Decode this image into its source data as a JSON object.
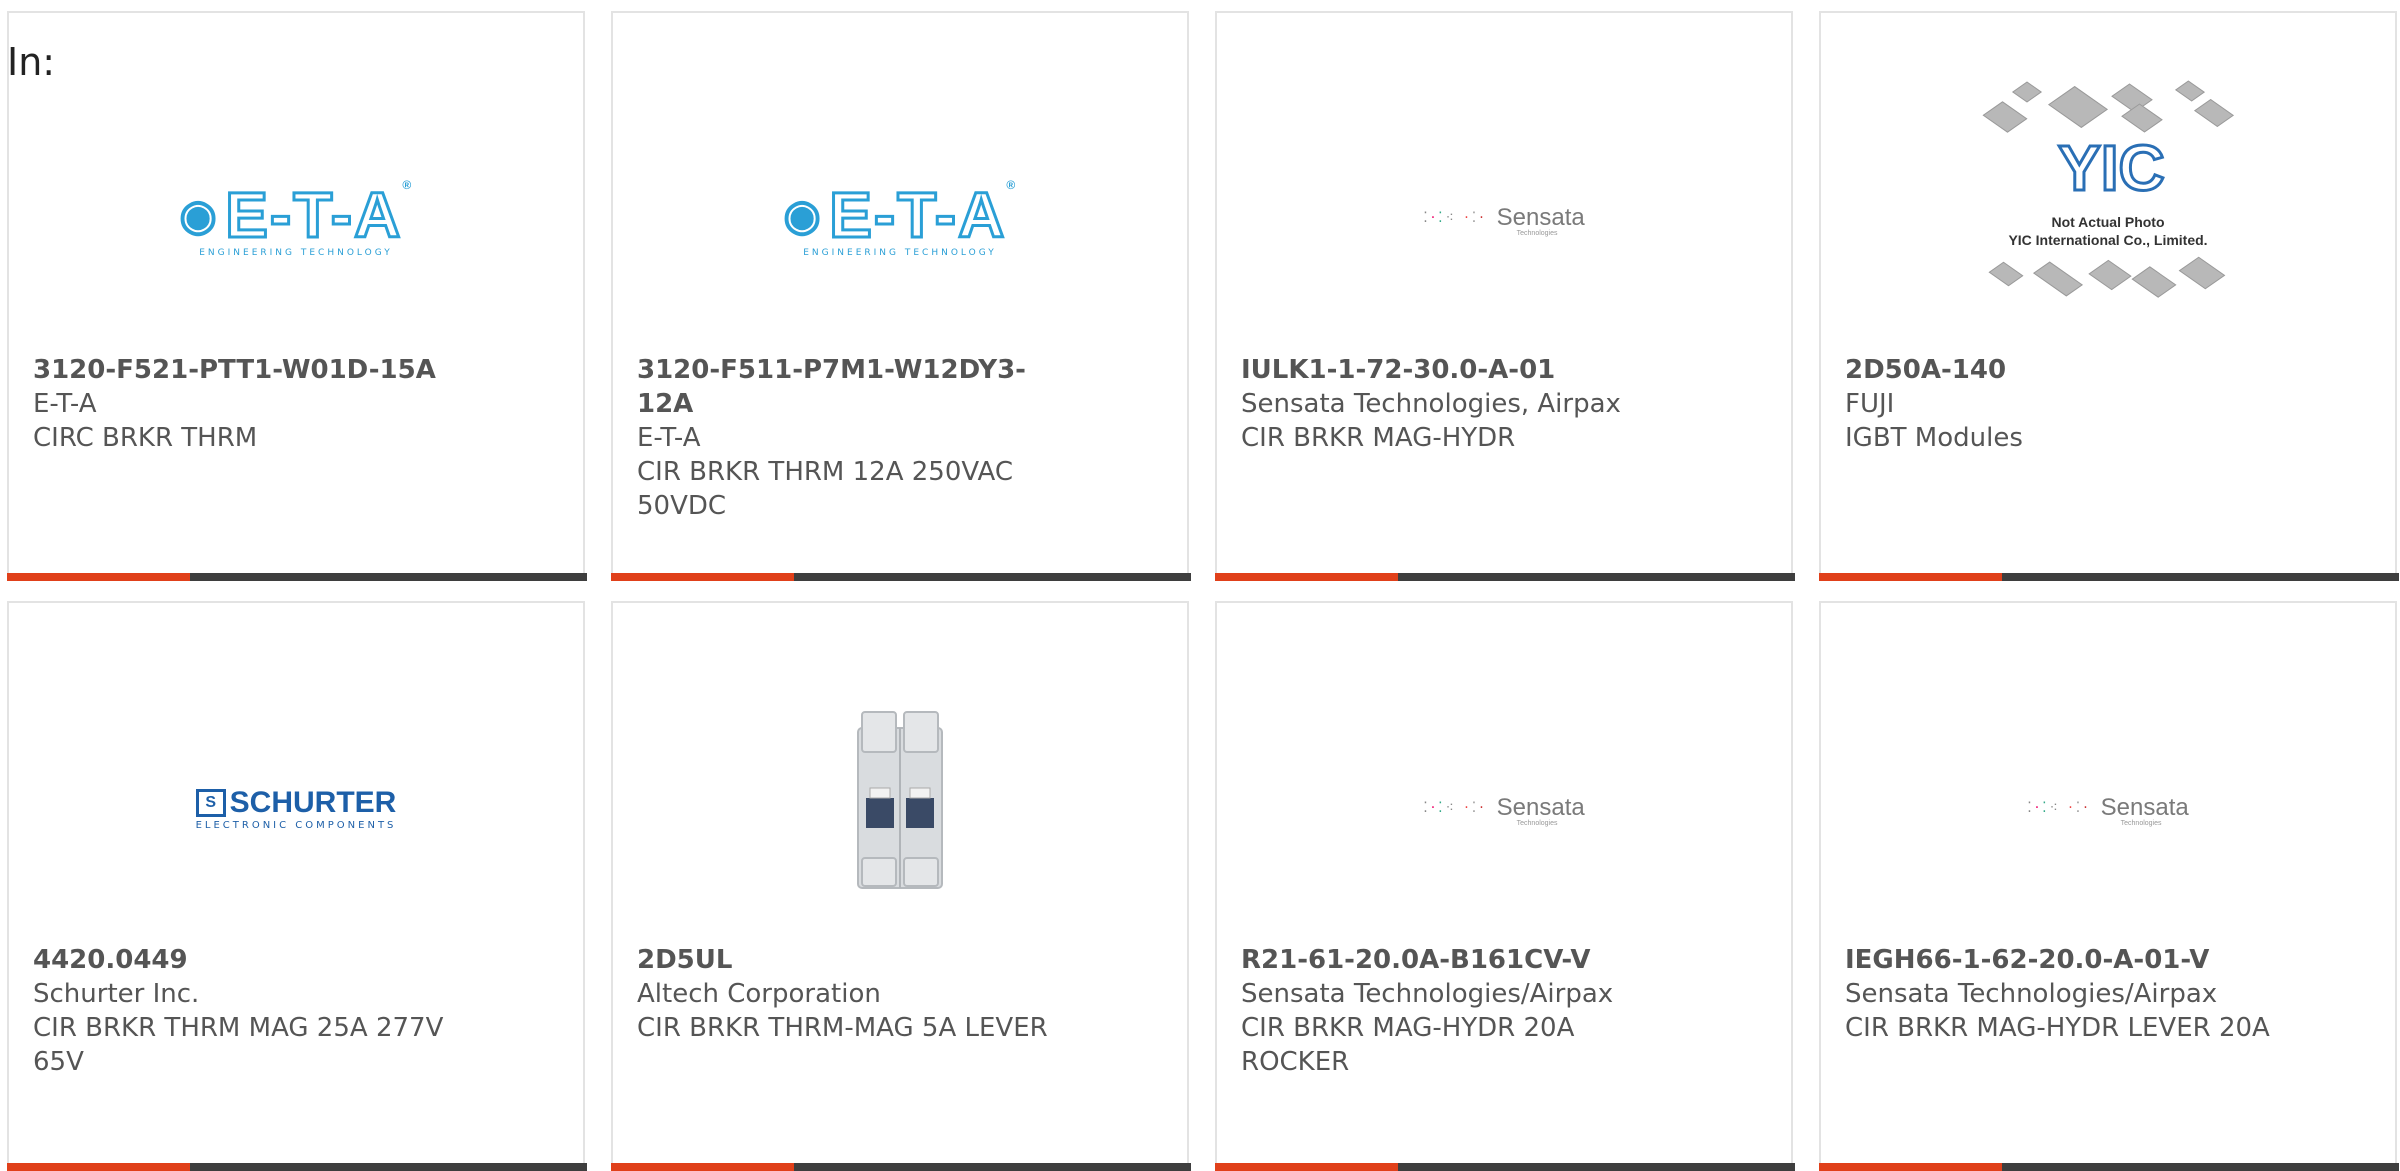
{
  "page": {
    "in_label": "In:"
  },
  "colors": {
    "accent_bar": "#e0401a",
    "dark_bar": "#3e3e3e",
    "text": "#555555"
  },
  "products": [
    {
      "part_number": "3120-F521-PTT1-W01D-15A",
      "manufacturer": "E-T-A",
      "description": "CIRC BRKR THRM",
      "image": "eta-logo",
      "logo_word": "E-T-A",
      "logo_sub": "ENGINEERING TECHNOLOGY"
    },
    {
      "part_number": "3120-F511-P7M1-W12DY3-12A",
      "manufacturer": "E-T-A",
      "description": "CIR BRKR THRM 12A 250VAC 50VDC",
      "image": "eta-logo",
      "logo_word": "E-T-A",
      "logo_sub": "ENGINEERING TECHNOLOGY"
    },
    {
      "part_number": "IULK1-1-72-30.0-A-01",
      "manufacturer": "Sensata Technologies, Airpax",
      "description": "CIR BRKR MAG-HYDR",
      "image": "sensata-logo",
      "logo_word": "Sensata",
      "logo_sub": "Technologies"
    },
    {
      "part_number": "2D50A-140",
      "manufacturer": "FUJI",
      "description": "IGBT Modules",
      "image": "yic-placeholder",
      "logo_word": "YIC",
      "logo_caption_1": "Not Actual Photo",
      "logo_caption_2": "YIC International Co., Limited."
    },
    {
      "part_number": "4420.0449",
      "manufacturer": "Schurter Inc.",
      "description": "CIR BRKR THRM MAG 25A 277V 65V",
      "image": "schurter-logo",
      "logo_word": "SCHURTER",
      "logo_sub": "ELECTRONIC COMPONENTS"
    },
    {
      "part_number": "2D5UL",
      "manufacturer": "Altech Corporation",
      "description": "CIR BRKR THRM-MAG 5A LEVER",
      "image": "breaker-photo"
    },
    {
      "part_number": "R21-61-20.0A-B161CV-V",
      "manufacturer": "Sensata Technologies/Airpax",
      "description": "CIR BRKR MAG-HYDR 20A ROCKER",
      "image": "sensata-logo",
      "logo_word": "Sensata",
      "logo_sub": "Technologies"
    },
    {
      "part_number": "IEGH66-1-62-20.0-A-01-V",
      "manufacturer": "Sensata Technologies/Airpax",
      "description": "CIR BRKR MAG-HYDR LEVER 20A",
      "image": "sensata-logo",
      "logo_word": "Sensata",
      "logo_sub": "Technologies"
    }
  ]
}
